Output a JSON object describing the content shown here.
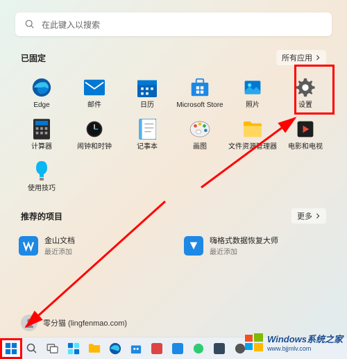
{
  "search": {
    "placeholder": "在此键入以搜索"
  },
  "pinned": {
    "title": "已固定",
    "action": "所有应用",
    "apps": [
      {
        "name": "Edge"
      },
      {
        "name": "邮件"
      },
      {
        "name": "日历"
      },
      {
        "name": "Microsoft Store"
      },
      {
        "name": "照片"
      },
      {
        "name": "设置"
      },
      {
        "name": "计算器"
      },
      {
        "name": "闹钟和时钟"
      },
      {
        "name": "记事本"
      },
      {
        "name": "画图"
      },
      {
        "name": "文件资源管理器"
      },
      {
        "name": "电影和电视"
      },
      {
        "name": "使用技巧"
      }
    ]
  },
  "recommended": {
    "title": "推荐的项目",
    "action": "更多",
    "items": [
      {
        "title": "金山文档",
        "sub": "最近添加"
      },
      {
        "title": "嗨格式数据恢复大师",
        "sub": "最近添加"
      }
    ]
  },
  "user": {
    "display": "零分猫 (lingfenmao.com)"
  },
  "watermark": {
    "title": "Windows系统之家",
    "url": "www.bjjmlv.com"
  }
}
